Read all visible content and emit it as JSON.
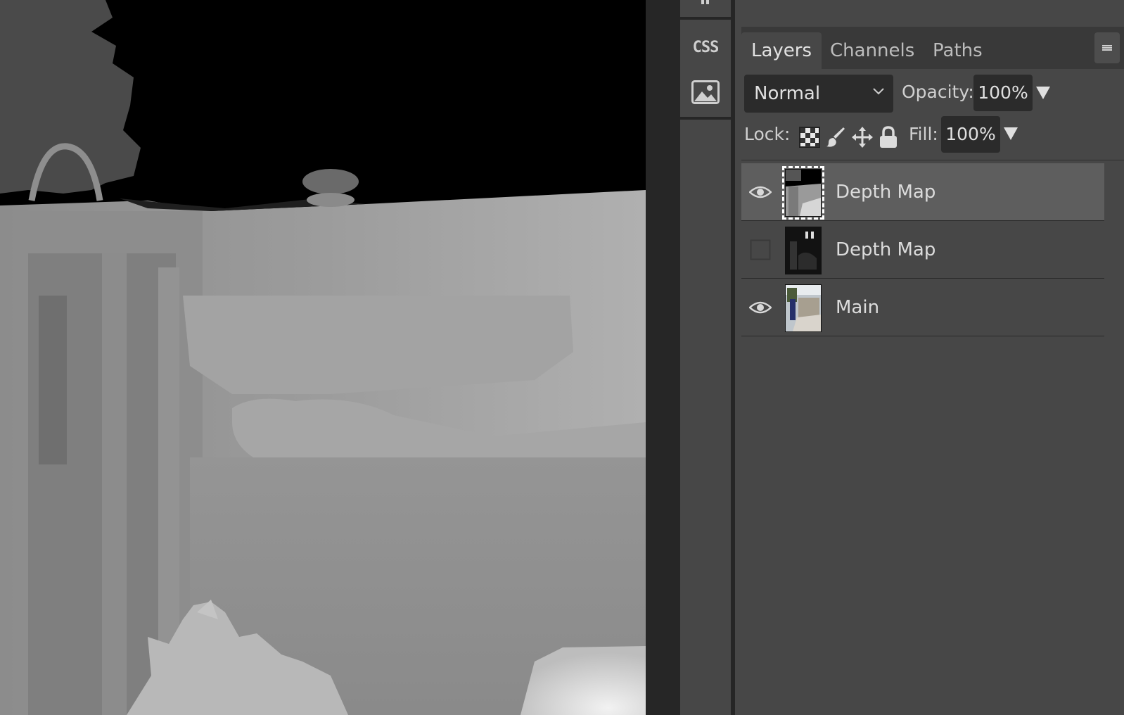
{
  "tool_strip": {
    "css_label": "CSS",
    "icons": [
      "pause-icon",
      "css-icon",
      "image-icon"
    ]
  },
  "panel": {
    "tabs": [
      {
        "label": "Layers",
        "active": true
      },
      {
        "label": "Channels",
        "active": false
      },
      {
        "label": "Paths",
        "active": false
      }
    ],
    "blend_mode": "Normal",
    "opacity_label": "Opacity:",
    "opacity_value": "100%",
    "lock_label": "Lock:",
    "fill_label": "Fill:",
    "fill_value": "100%",
    "lock_icons": [
      "transparency-lock-icon",
      "brush-lock-icon",
      "move-lock-icon",
      "padlock-icon"
    ]
  },
  "layers": [
    {
      "name": "Depth Map",
      "visible": true,
      "selected": true
    },
    {
      "name": "Depth Map",
      "visible": false,
      "selected": false
    },
    {
      "name": "Main",
      "visible": true,
      "selected": false
    }
  ],
  "colors": {
    "panel_bg": "#474747",
    "tab_bar_bg": "#393939",
    "field_bg": "#2b2b2b",
    "selected_row": "#5e5e5e",
    "gutter": "#262626"
  }
}
